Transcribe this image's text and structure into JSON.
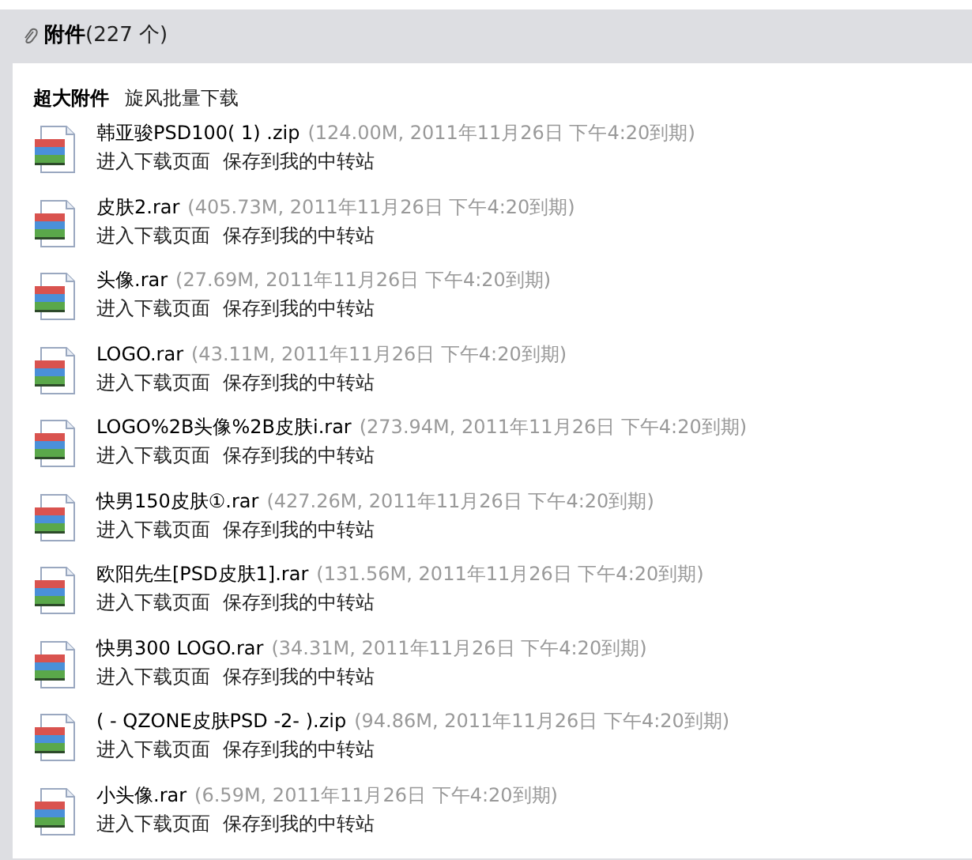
{
  "header": {
    "title": "附件",
    "count": "(227 个)"
  },
  "toolbar": {
    "label": "超大附件",
    "link": "旋风批量下载"
  },
  "files": [
    {
      "name": "韩亚骏PSD100( 1) .zip",
      "meta": "(124.00M, 2011年11月26日 下午4:20到期)",
      "actions": [
        "进入下载页面",
        "保存到我的中转站"
      ]
    },
    {
      "name": "皮肤2.rar",
      "meta": "(405.73M, 2011年11月26日 下午4:20到期)",
      "actions": [
        "进入下载页面",
        "保存到我的中转站"
      ]
    },
    {
      "name": "头像.rar",
      "meta": "(27.69M, 2011年11月26日 下午4:20到期)",
      "actions": [
        "进入下载页面",
        "保存到我的中转站"
      ]
    },
    {
      "name": "LOGO.rar",
      "meta": "(43.11M, 2011年11月26日 下午4:20到期)",
      "actions": [
        "进入下载页面",
        "保存到我的中转站"
      ]
    },
    {
      "name": "LOGO%2B头像%2B皮肤i.rar",
      "meta": "(273.94M, 2011年11月26日 下午4:20到期)",
      "actions": [
        "进入下载页面",
        "保存到我的中转站"
      ]
    },
    {
      "name": "快男150皮肤①.rar",
      "meta": "(427.26M, 2011年11月26日 下午4:20到期)",
      "actions": [
        "进入下载页面",
        "保存到我的中转站"
      ]
    },
    {
      "name": "欧阳先生[PSD皮肤1].rar",
      "meta": "(131.56M, 2011年11月26日 下午4:20到期)",
      "actions": [
        "进入下载页面",
        "保存到我的中转站"
      ]
    },
    {
      "name": "快男300 LOGO.rar",
      "meta": "(34.31M, 2011年11月26日 下午4:20到期)",
      "actions": [
        "进入下载页面",
        "保存到我的中转站"
      ]
    },
    {
      "name": "( - QZONE皮肤PSD -2- ).zip",
      "meta": "(94.86M, 2011年11月26日 下午4:20到期)",
      "actions": [
        "进入下载页面",
        "保存到我的中转站"
      ]
    },
    {
      "name": "小头像.rar",
      "meta": "(6.59M, 2011年11月26日 下午4:20到期)",
      "actions": [
        "进入下载页面",
        "保存到我的中转站"
      ]
    }
  ]
}
